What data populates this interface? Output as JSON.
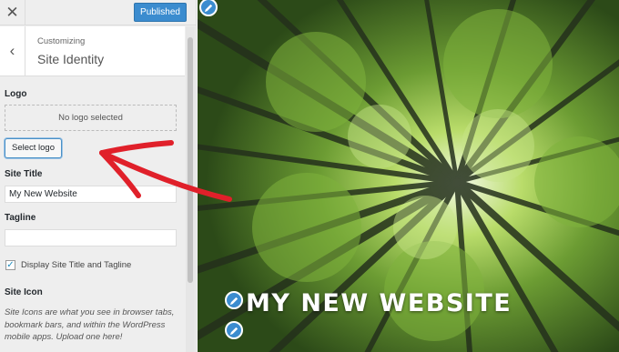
{
  "topbar": {
    "close_glyph": "✕",
    "publish_label": "Published"
  },
  "section": {
    "back_glyph": "‹",
    "parent": "Customizing",
    "title": "Site Identity"
  },
  "logo": {
    "label": "Logo",
    "placeholder": "No logo selected",
    "select_button": "Select logo"
  },
  "site_title": {
    "label": "Site Title",
    "value": "My New Website"
  },
  "tagline": {
    "label": "Tagline",
    "value": ""
  },
  "display_toggle": {
    "checked": true,
    "check_glyph": "✓",
    "label": "Display Site Title and Tagline"
  },
  "site_icon": {
    "label": "Site Icon",
    "description": "Site Icons are what you see in browser tabs, bookmark bars, and within the WordPress mobile apps. Upload one here!"
  },
  "preview": {
    "heading": "MY NEW WEBSITE"
  },
  "colors": {
    "accent": "#3b8ccf",
    "annotation": "#e0202a"
  },
  "icons": [
    "close-icon",
    "chevron-left-icon",
    "checkmark-icon",
    "pencil-icon"
  ]
}
